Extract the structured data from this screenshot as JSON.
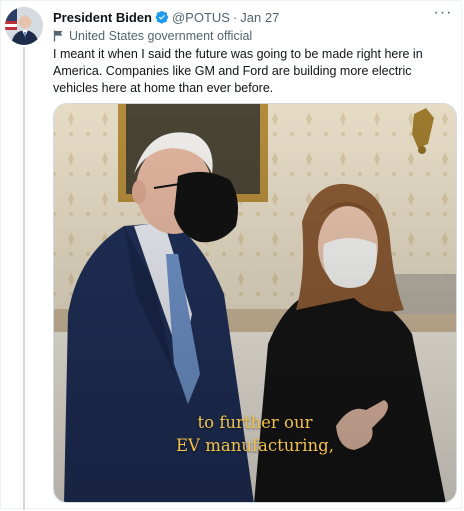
{
  "tweet": {
    "author_name": "President Biden",
    "handle": "@POTUS",
    "separator": "·",
    "date": "Jan 27",
    "account_label": "United States government official",
    "text": "I meant it when I said the future was going to be made right here in America. Companies like GM and Ford are building more electric vehicles here at home than ever before.",
    "more_glyph": "···"
  },
  "media": {
    "caption_line1": "to further our",
    "caption_line2": "EV manufacturing,"
  },
  "colors": {
    "verified": "#1d9bf0",
    "secondary_text": "#536471",
    "caption": "#f2c24a"
  },
  "icons": {
    "verified": "verified-badge-icon",
    "government": "flag-icon",
    "more": "more-options-icon"
  }
}
